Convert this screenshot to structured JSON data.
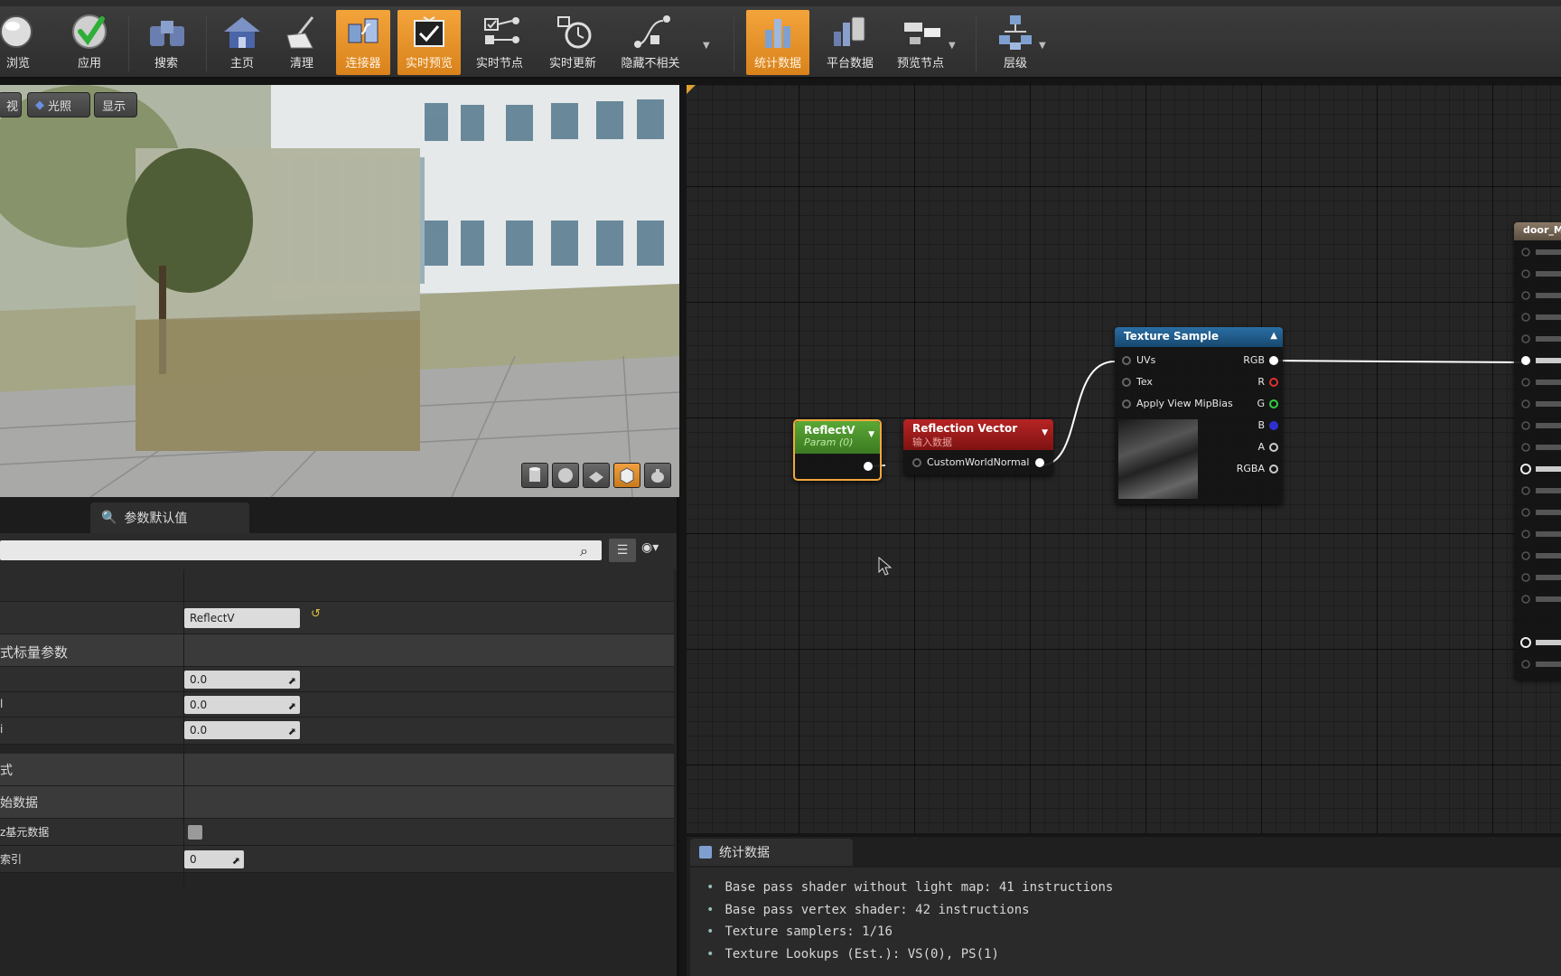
{
  "toolbar": {
    "buttons": [
      {
        "label": "浏览",
        "icon": "sphere-icon"
      },
      {
        "label": "应用",
        "icon": "checkmark-icon"
      },
      {
        "label": "搜索",
        "icon": "binoculars-icon"
      },
      {
        "label": "主页",
        "icon": "house-icon"
      },
      {
        "label": "清理",
        "icon": "broom-icon"
      },
      {
        "label": "连接器",
        "icon": "connector-icon",
        "active": true
      },
      {
        "label": "实时预览",
        "icon": "live-preview-icon",
        "active": true
      },
      {
        "label": "实时节点",
        "icon": "live-nodes-icon"
      },
      {
        "label": "实时更新",
        "icon": "live-update-icon"
      },
      {
        "label": "隐藏不相关",
        "icon": "hide-unrelated-icon"
      },
      {
        "label": "统计数据",
        "icon": "stats-icon",
        "active": true
      },
      {
        "label": "平台数据",
        "icon": "platform-stats-icon"
      },
      {
        "label": "预览节点",
        "icon": "preview-node-icon"
      },
      {
        "label": "层级",
        "icon": "hierarchy-icon"
      }
    ]
  },
  "viewport": {
    "buttons": [
      "视",
      "光照",
      "显示"
    ],
    "bottom_icons": [
      "cylinder-icon",
      "sphere-icon",
      "plane-icon",
      "cube-icon",
      "teapot-icon"
    ]
  },
  "details": {
    "tab_label": "参数默认值",
    "rows": {
      "param_name_value": "ReflectV",
      "section_scalar": "式标量参数",
      "num1": "0.0",
      "num2": "0.0",
      "num3": "0.0",
      "k2": "l",
      "k3": "i",
      "section_expression": "式",
      "section_raw": "始数据",
      "k_primitive": "z基元数据",
      "k_index": "索引",
      "index_value": "0"
    }
  },
  "graph": {
    "reflectv_node": {
      "title": "ReflectV",
      "subtitle": "Param (0)"
    },
    "reflection_vector_node": {
      "title": "Reflection Vector",
      "subtitle": "输入数据",
      "pin": "CustomWorldNormal"
    },
    "texture_sample_node": {
      "title": "Texture Sample",
      "inputs": [
        "UVs",
        "Tex",
        "Apply View MipBias"
      ],
      "outputs": [
        "RGB",
        "R",
        "G",
        "B",
        "A",
        "RGBA"
      ]
    },
    "material_node": {
      "title": "door_M"
    },
    "colors": {
      "r": "#e03030",
      "g": "#30d040",
      "b": "#3030d0",
      "param_header": "#4f9a2a",
      "vector_header": "#a01c1c",
      "texture_header": "#1f5a88"
    }
  },
  "stats": {
    "tab_label": "统计数据",
    "lines": [
      "Base pass shader without light map: 41 instructions",
      "Base pass vertex shader: 42 instructions",
      "Texture samplers: 1/16",
      "Texture Lookups (Est.): VS(0), PS(1)"
    ]
  }
}
